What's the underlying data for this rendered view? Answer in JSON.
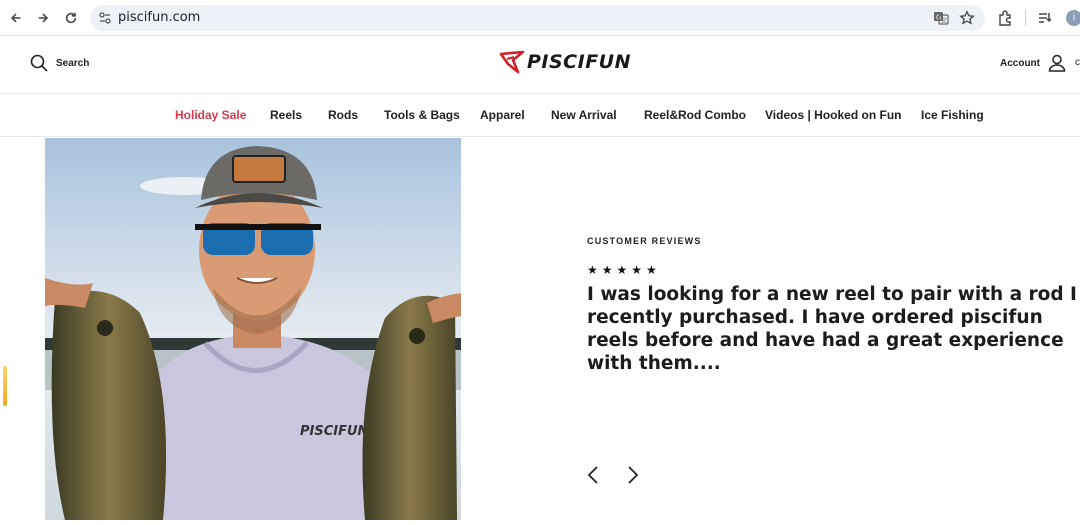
{
  "browser": {
    "url": "piscifun.com",
    "profile_initial": "i",
    "icons": [
      "back-icon",
      "forward-icon",
      "reload-icon",
      "site-info-icon",
      "translate-icon",
      "bookmark-star-icon",
      "extensions-icon",
      "reading-list-icon"
    ]
  },
  "header": {
    "search_label": "Search",
    "logo_text": "PISCIFUN",
    "account_label": "Account"
  },
  "menu": {
    "items": [
      {
        "label": "Holiday Sale"
      },
      {
        "label": "Reels"
      },
      {
        "label": "Rods"
      },
      {
        "label": "Tools & Bags"
      },
      {
        "label": "Apparel"
      },
      {
        "label": "New Arrival"
      },
      {
        "label": "Reel&Rod Combo"
      },
      {
        "label": "Videos | Hooked on Fun"
      },
      {
        "label": "Ice Fishing"
      }
    ],
    "sale_color": "#d63a4a"
  },
  "hero": {
    "shirt_text": "PISCIFUN"
  },
  "review": {
    "label": "CUSTOMER REVIEWS",
    "stars": "★★★★★",
    "rating": 5,
    "quote": "I was looking for a new reel to pair with a rod I recently purchased. I have ordered piscifun reels before and have had a great experience with them...."
  },
  "colors": {
    "accent": "#d63a4a",
    "logo_red": "#d0202a"
  }
}
